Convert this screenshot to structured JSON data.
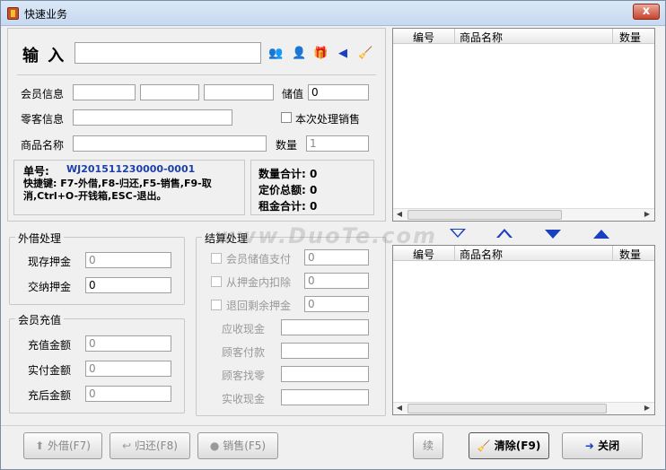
{
  "window": {
    "title": "快速业务",
    "close_label": "x"
  },
  "input_section": {
    "input_label": "输 入",
    "member_info_label": "会员信息",
    "stored_value_label": "储值",
    "stored_value": "0",
    "retail_info_label": "零客信息",
    "process_sale_label": "本次处理销售",
    "product_name_label": "商品名称",
    "quantity_label": "数量",
    "quantity": "1"
  },
  "info": {
    "order_no_label": "单号:",
    "order_no": "WJ201511230000-0001",
    "shortcut_text": "快捷键: F7-外借,F8-归还,F5-销售,F9-取消,Ctrl+O-开钱箱,ESC-退出。",
    "qty_total": "数量合计: 0",
    "price_total": "定价总额: 0",
    "rent_total": "租金合计: 0"
  },
  "borrow": {
    "title": "外借处理",
    "current_deposit_label": "现存押金",
    "current_deposit": "0",
    "pay_deposit_label": "交纳押金",
    "pay_deposit": "0"
  },
  "recharge": {
    "title": "会员充值",
    "amount_label": "充值金额",
    "amount": "0",
    "paid_label": "实付金额",
    "paid": "0",
    "after_label": "充后金额",
    "after": "0"
  },
  "settle": {
    "title": "结算处理",
    "member_pay_label": "会员储值支付",
    "member_pay": "0",
    "deposit_deduct_label": "从押金内扣除",
    "deposit_deduct": "0",
    "refund_label": "退回剩余押金",
    "refund": "0",
    "receivable_label": "应收现金",
    "customer_paid_label": "顾客付款",
    "change_label": "顾客找零",
    "actual_label": "实收现金"
  },
  "grid": {
    "col_no": "编号",
    "col_name": "商品名称",
    "col_qty": "数量"
  },
  "buttons": {
    "borrow": "外借(F7)",
    "return": "归还(F8)",
    "sell": "销售(F5)",
    "continue": "续",
    "clear": "清除(F9)",
    "close": "关闭"
  },
  "watermark": "www.DuoTe.com",
  "colors": {
    "title_bg": "#c6d9f0",
    "order_no": "#1c3ea8",
    "arrow_blue": "#1a3fbf"
  }
}
